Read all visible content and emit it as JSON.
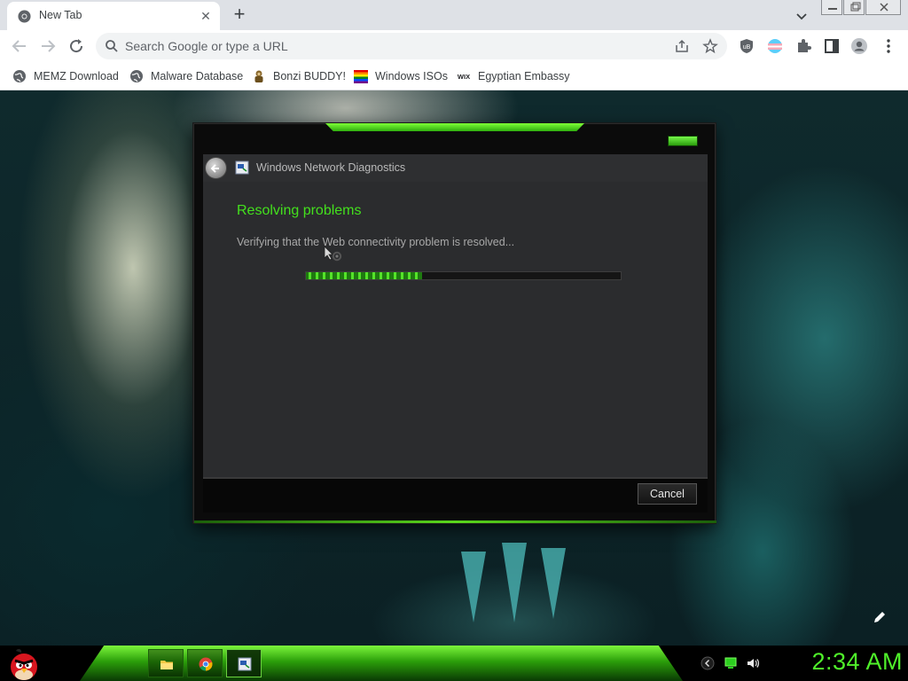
{
  "browser": {
    "tab": {
      "title": "New Tab",
      "favicon": "chrome-icon"
    },
    "omnibox": {
      "placeholder": "Search Google or type a URL"
    },
    "bookmarks": [
      {
        "label": "MEMZ Download",
        "icon": "globe-icon"
      },
      {
        "label": "Malware Database",
        "icon": "globe-icon"
      },
      {
        "label": "Bonzi BUDDY!",
        "icon": "bonzi-icon"
      },
      {
        "label": "Windows ISOs",
        "icon": "rainbow-flag-icon"
      },
      {
        "label": "Egyptian Embassy",
        "icon": "wix-icon"
      }
    ]
  },
  "dialog": {
    "title": "Windows Network Diagnostics",
    "heading": "Resolving problems",
    "status": "Verifying that the Web connectivity problem is resolved...",
    "progress_fraction": 0.37,
    "cancel_label": "Cancel"
  },
  "taskbar": {
    "clock": "2:34 AM",
    "buttons": [
      "file-explorer-icon",
      "chrome-icon",
      "network-diagnostics-icon"
    ],
    "tray": [
      "chevron-icon",
      "network-icon",
      "volume-icon"
    ]
  },
  "colors": {
    "accent_green": "#43e01d",
    "clock_green": "#4ff02a",
    "dialog_body": "#2b2c2e"
  }
}
